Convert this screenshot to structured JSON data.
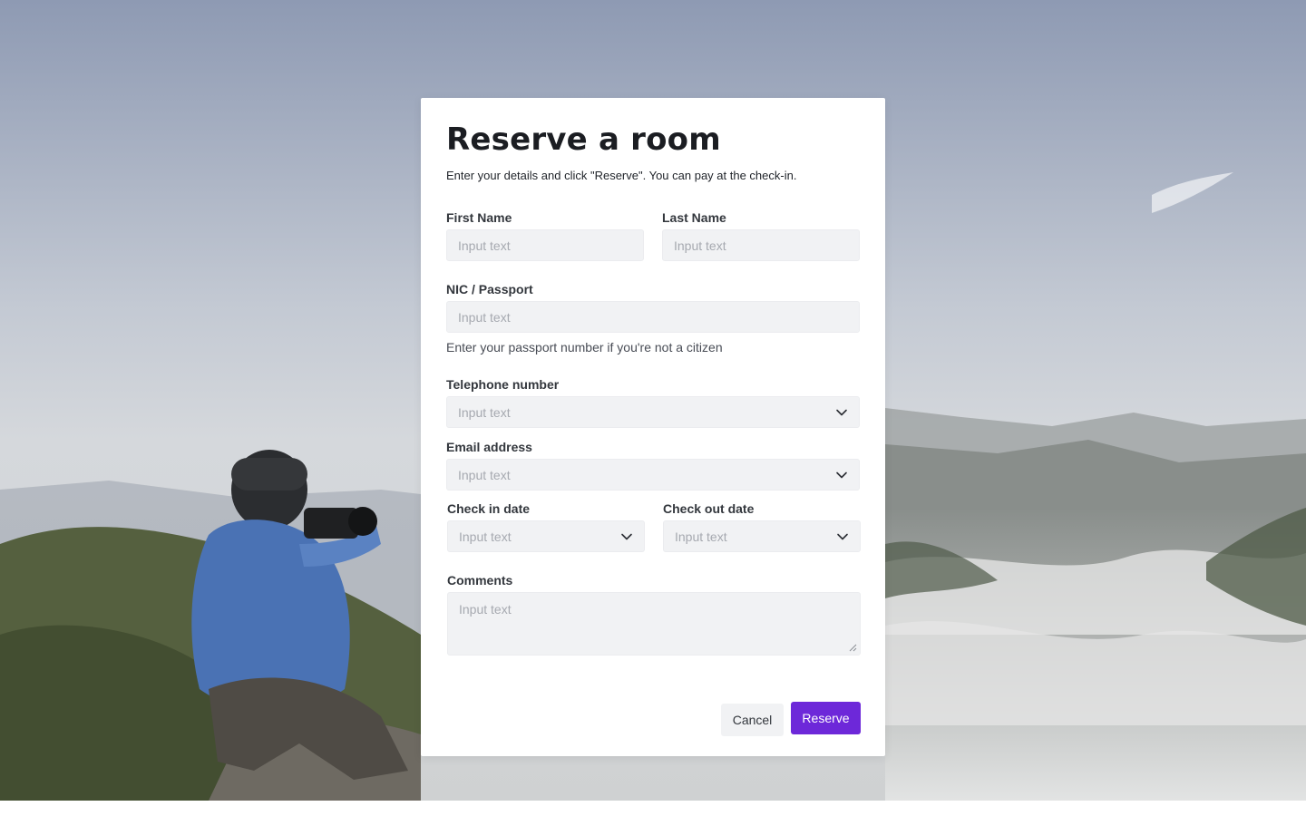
{
  "modal": {
    "title": "Reserve a room",
    "subtitle": "Enter your details and click \"Reserve\". You can pay at the check-in."
  },
  "form": {
    "first_name": {
      "label": "First Name",
      "placeholder": "Input text"
    },
    "last_name": {
      "label": "Last Name",
      "placeholder": "Input text"
    },
    "nic_passport": {
      "label": "NIC / Passport",
      "placeholder": "Input text",
      "helper": "Enter your passport number if you're not a citizen"
    },
    "telephone": {
      "label": "Telephone number",
      "placeholder": "Input text",
      "icon": "chevron-down-icon"
    },
    "email": {
      "label": "Email address",
      "placeholder": "Input text",
      "icon": "chevron-down-icon"
    },
    "check_in": {
      "label": "Check in date",
      "placeholder": "Input text",
      "icon": "chevron-down-icon"
    },
    "check_out": {
      "label": "Check out date",
      "placeholder": "Input text",
      "icon": "chevron-down-icon"
    },
    "comments": {
      "label": "Comments",
      "placeholder": "Input text"
    }
  },
  "actions": {
    "cancel_label": "Cancel",
    "reserve_label": "Reserve"
  },
  "colors": {
    "accent": "#6d28d9",
    "input_background": "#f1f2f4",
    "modal_background": "#ffffff"
  }
}
